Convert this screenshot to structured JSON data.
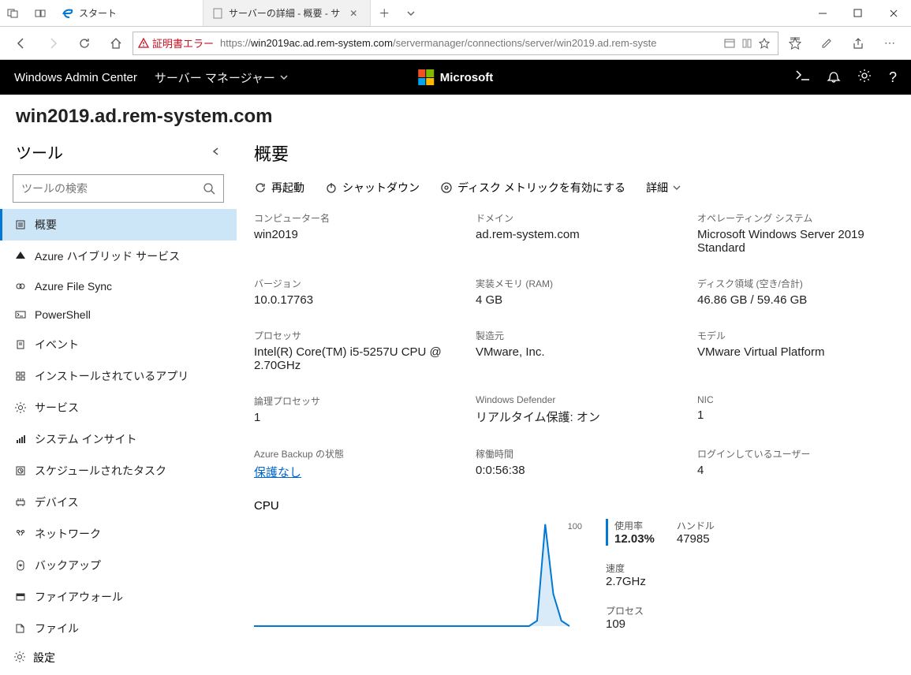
{
  "tabs": [
    {
      "title": "スタート",
      "favicon": "#0078d4"
    },
    {
      "title": "サーバーの詳細 - 概要 - サ",
      "favicon": "#888"
    }
  ],
  "cert_error": "証明書エラー",
  "url_prefix": "https://",
  "url_host": "win2019ac.ad.rem-system.com",
  "url_path": "/servermanager/connections/server/win2019.ad.rem-syste",
  "app_brand": "Windows Admin Center",
  "app_breadcrumb": "サーバー マネージャー",
  "ms_label": "Microsoft",
  "page_title": "win2019.ad.rem-system.com",
  "sidebar_title": "ツール",
  "search_placeholder": "ツールの検索",
  "tools": [
    "概要",
    "Azure ハイブリッド サービス",
    "Azure File Sync",
    "PowerShell",
    "イベント",
    "インストールされているアプリ",
    "サービス",
    "システム インサイト",
    "スケジュールされたタスク",
    "デバイス",
    "ネットワーク",
    "バックアップ",
    "ファイアウォール",
    "ファイル"
  ],
  "settings": "設定",
  "overview_title": "概要",
  "actions": {
    "restart": "再起動",
    "shutdown": "シャットダウン",
    "disk": "ディスク メトリックを有効にする",
    "more": "詳細"
  },
  "props": [
    {
      "label": "コンピューター名",
      "value": "win2019"
    },
    {
      "label": "ドメイン",
      "value": "ad.rem-system.com"
    },
    {
      "label": "オペレーティング システム",
      "value": "Microsoft Windows Server 2019 Standard"
    },
    {
      "label": "バージョン",
      "value": "10.0.17763"
    },
    {
      "label": "実装メモリ (RAM)",
      "value": "4 GB"
    },
    {
      "label": "ディスク領域 (空き/合計)",
      "value": "46.86 GB / 59.46 GB"
    },
    {
      "label": "プロセッサ",
      "value": "Intel(R) Core(TM) i5-5257U CPU @ 2.70GHz"
    },
    {
      "label": "製造元",
      "value": "VMware, Inc."
    },
    {
      "label": "モデル",
      "value": "VMware Virtual Platform"
    },
    {
      "label": "論理プロセッサ",
      "value": "1"
    },
    {
      "label": "Windows Defender",
      "value": "リアルタイム保護: オン"
    },
    {
      "label": "NIC",
      "value": "1"
    },
    {
      "label": "Azure Backup の状態",
      "value": "保護なし",
      "link": true
    },
    {
      "label": "稼働時間",
      "value": "0:0:56:38"
    },
    {
      "label": "ログインしているユーザー",
      "value": "4"
    }
  ],
  "cpu_label": "CPU",
  "chart_data": {
    "type": "line",
    "title": "CPU",
    "xlabel": "",
    "ylabel": "",
    "ylim": [
      0,
      100
    ],
    "ylabeltop": "100",
    "x": [
      0,
      1,
      2,
      3,
      4,
      5,
      6,
      7,
      8,
      9,
      10,
      11,
      12,
      13,
      14,
      15,
      16,
      17,
      18,
      19,
      20,
      21,
      22,
      23,
      24,
      25,
      26,
      27,
      28,
      29,
      30,
      31,
      32,
      33,
      34,
      35,
      36,
      37,
      38,
      39
    ],
    "values": [
      0,
      0,
      0,
      0,
      0,
      0,
      0,
      0,
      0,
      0,
      0,
      0,
      0,
      0,
      0,
      0,
      0,
      0,
      0,
      0,
      0,
      0,
      0,
      0,
      0,
      0,
      0,
      0,
      0,
      0,
      0,
      0,
      0,
      0,
      0,
      5,
      95,
      30,
      5,
      0
    ]
  },
  "cpu_stats": {
    "util_label": "使用率",
    "util_value": "12.03%",
    "handles_label": "ハンドル",
    "handles_value": "47985",
    "speed_label": "速度",
    "speed_value": "2.7GHz",
    "procs_label": "プロセス",
    "procs_value": "109"
  }
}
